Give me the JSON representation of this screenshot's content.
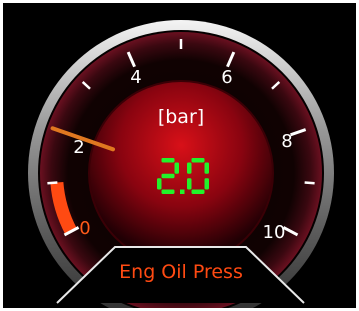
{
  "gauge": {
    "title": "Eng Oil Press",
    "unit": "[bar]",
    "readout": "2.0",
    "value": 2.0,
    "min": 0,
    "max": 10,
    "tick_labels": [
      "0",
      "2",
      "4",
      "6",
      "8",
      "10"
    ],
    "low_warning_limit": 1.0
  },
  "colors": {
    "background": "#000000",
    "accent": "#ff4a12",
    "readout": "#22f22a",
    "dial_red": "#c40814",
    "needle": "#e07820",
    "bezel": "#c8c8c8"
  }
}
